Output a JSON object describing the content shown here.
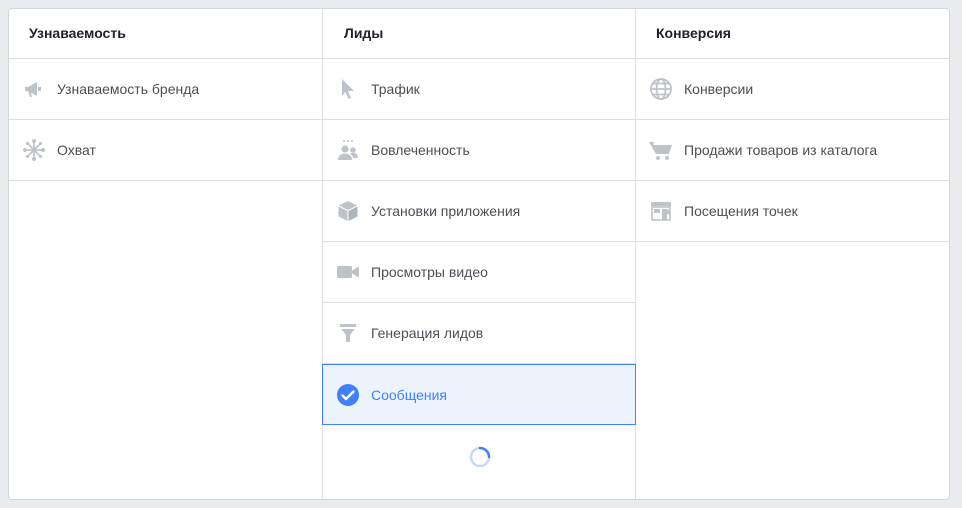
{
  "columns": [
    {
      "header": "Узнаваемость",
      "options": [
        {
          "label": "Узнаваемость бренда",
          "icon": "megaphone-icon"
        },
        {
          "label": "Охват",
          "icon": "reach-icon"
        }
      ]
    },
    {
      "header": "Лиды",
      "options": [
        {
          "label": "Трафик",
          "icon": "cursor-icon"
        },
        {
          "label": "Вовлеченность",
          "icon": "people-icon"
        },
        {
          "label": "Установки приложения",
          "icon": "cube-icon"
        },
        {
          "label": "Просмотры видео",
          "icon": "video-camera-icon"
        },
        {
          "label": "Генерация лидов",
          "icon": "funnel-icon"
        },
        {
          "label": "Сообщения",
          "icon": "checkmark-circle-icon",
          "selected": true
        }
      ]
    },
    {
      "header": "Конверсия",
      "options": [
        {
          "label": "Конверсии",
          "icon": "globe-icon"
        },
        {
          "label": "Продажи товаров из каталога",
          "icon": "shopping-cart-icon"
        },
        {
          "label": "Посещения точек",
          "icon": "store-icon"
        }
      ]
    }
  ],
  "colors": {
    "icon": "#bec3c9",
    "selected_accent": "#4080ff",
    "selected_bg": "#ecf3fc",
    "border": "#dddfe2"
  },
  "loading": true
}
